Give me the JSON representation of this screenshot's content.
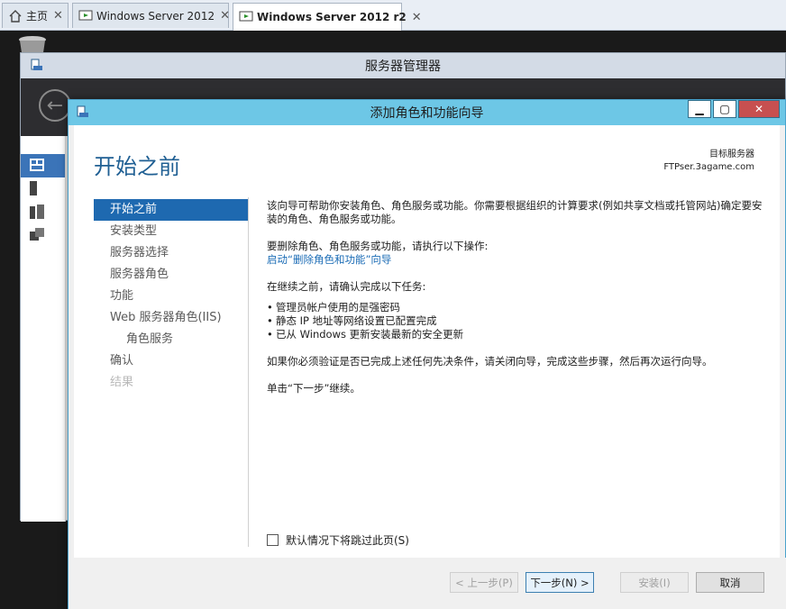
{
  "tabs": [
    {
      "label": "主页",
      "icon": "home-icon",
      "active": false
    },
    {
      "label": "Windows Server 2012",
      "icon": "vm-icon",
      "active": false
    },
    {
      "label": "Windows Server 2012 r2",
      "icon": "vm-icon",
      "active": true
    }
  ],
  "server_manager": {
    "title": "服务器管理器"
  },
  "wizard": {
    "title": "添加角色和功能向导",
    "heading": "开始之前",
    "target_label": "目标服务器",
    "target_server": "FTPser.3agame.com",
    "steps": [
      {
        "label": "开始之前",
        "state": "selected"
      },
      {
        "label": "安装类型",
        "state": "normal"
      },
      {
        "label": "服务器选择",
        "state": "normal"
      },
      {
        "label": "服务器角色",
        "state": "normal"
      },
      {
        "label": "功能",
        "state": "normal"
      },
      {
        "label": "Web 服务器角色(IIS)",
        "state": "normal"
      },
      {
        "label": "角色服务",
        "state": "sub"
      },
      {
        "label": "确认",
        "state": "normal"
      },
      {
        "label": "结果",
        "state": "disabled"
      }
    ],
    "content": {
      "intro": "该向导可帮助你安装角色、角色服务或功能。你需要根据组织的计算要求(例如共享文档或托管网站)确定要安装的角色、角色服务或功能。",
      "remove_prompt": "要删除角色、角色服务或功能，请执行以下操作:",
      "remove_link": "启动“删除角色和功能”向导",
      "before_continue": "在继续之前，请确认完成以下任务:",
      "bullets": [
        "管理员帐户使用的是强密码",
        "静态 IP 地址等网络设置已配置完成",
        "已从 Windows 更新安装最新的安全更新"
      ],
      "verify_note": "如果你必须验证是否已完成上述任何先决条件，请关闭向导，完成这些步骤，然后再次运行向导。",
      "next_note": "单击“下一步”继续。"
    },
    "skip_label": "默认情况下将跳过此页(S)",
    "buttons": {
      "prev": "< 上一步(P)",
      "next": "下一步(N) >",
      "install": "安装(I)",
      "cancel": "取消"
    }
  }
}
